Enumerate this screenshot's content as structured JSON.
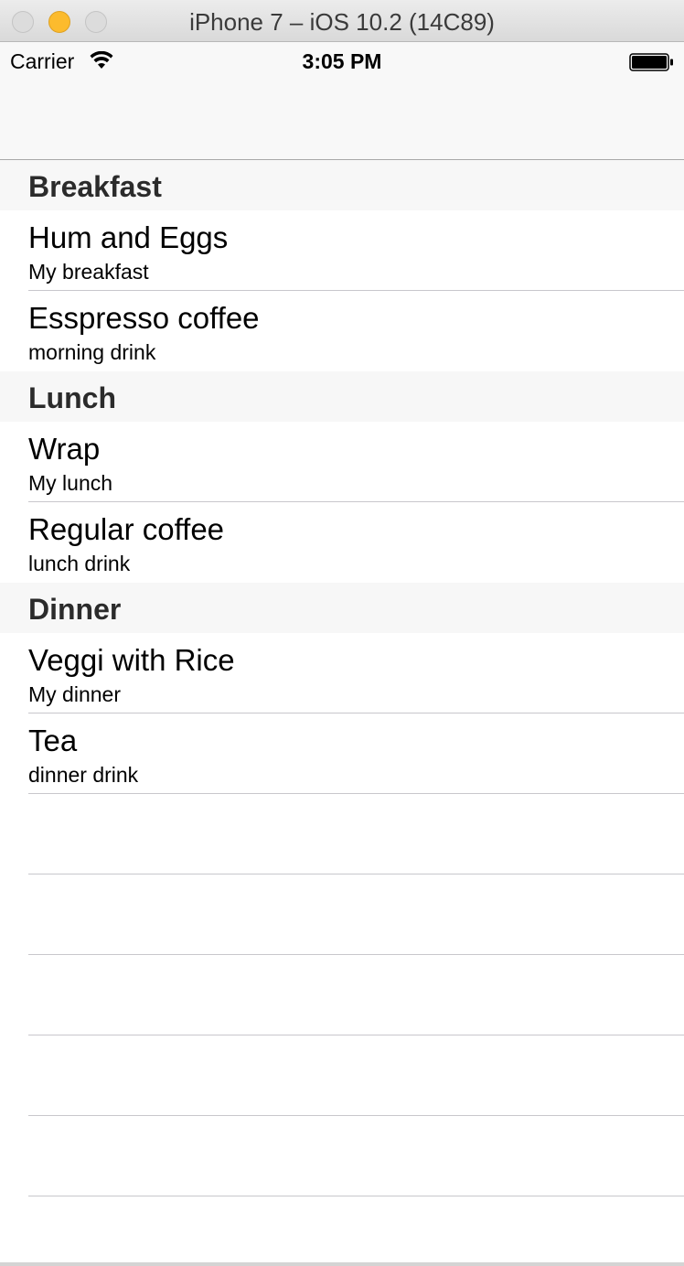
{
  "window": {
    "title": "iPhone 7 – iOS 10.2 (14C89)"
  },
  "status_bar": {
    "carrier": "Carrier",
    "time": "3:05 PM",
    "wifi_icon": "wifi-icon",
    "battery_icon": "battery-icon"
  },
  "colors": {
    "minimize_button": "#fcbb2d",
    "section_header_bg": "#f7f7f7",
    "separator": "#c8c7cc"
  },
  "sections": [
    {
      "header": "Breakfast",
      "rows": [
        {
          "title": "Hum and Eggs",
          "subtitle": "My breakfast"
        },
        {
          "title": "Esspresso coffee",
          "subtitle": "morning drink"
        }
      ]
    },
    {
      "header": "Lunch",
      "rows": [
        {
          "title": "Wrap",
          "subtitle": "My lunch"
        },
        {
          "title": "Regular coffee",
          "subtitle": "lunch drink"
        }
      ]
    },
    {
      "header": "Dinner",
      "rows": [
        {
          "title": "Veggi with Rice",
          "subtitle": "My dinner"
        },
        {
          "title": "Tea",
          "subtitle": "dinner drink"
        }
      ]
    }
  ]
}
